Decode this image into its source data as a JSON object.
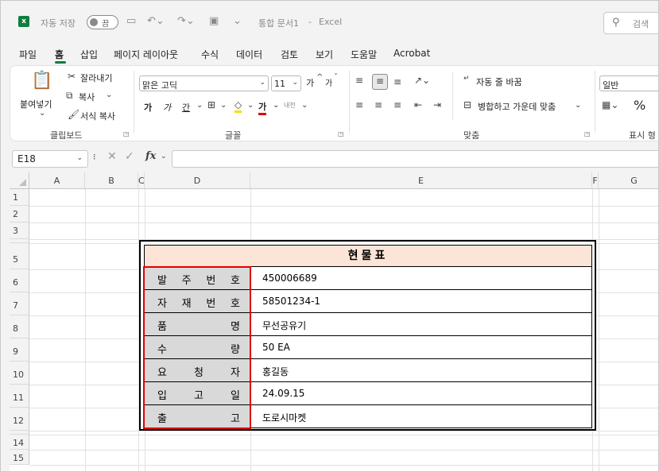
{
  "titlebar": {
    "autosave_label": "자동 저장",
    "autosave_state": "끔",
    "doc_title": "통합 문서1",
    "title_sep": "-",
    "app_name": "Excel",
    "search_placeholder": "검색"
  },
  "tabs": [
    {
      "label": "파일"
    },
    {
      "label": "홈"
    },
    {
      "label": "삽입"
    },
    {
      "label": "페이지 레이아웃"
    },
    {
      "label": "수식"
    },
    {
      "label": "데이터"
    },
    {
      "label": "검토"
    },
    {
      "label": "보기"
    },
    {
      "label": "도움말"
    },
    {
      "label": "Acrobat"
    }
  ],
  "ribbon": {
    "clipboard": {
      "paste": "붙여넣기",
      "cut": "잘라내기",
      "copy": "복사",
      "format_painter": "서식 복사",
      "group": "클립보드"
    },
    "font": {
      "font_name": "맑은 고딕",
      "font_size": "11",
      "bold": "가",
      "italic": "가",
      "underline": "간",
      "font_color_glyph": "가",
      "phonetic": "내천",
      "grow": "가",
      "shrink": "가",
      "group": "글꼴"
    },
    "alignment": {
      "wrap": "자동 줄 바꿈",
      "merge": "병합하고 가운데 맞춤",
      "group": "맞춤"
    },
    "number": {
      "format": "일반",
      "percent": "%",
      "group": "표시 형"
    }
  },
  "formula_bar": {
    "name_box": "E18",
    "formula": ""
  },
  "columns": [
    "A",
    "B",
    "C",
    "D",
    "E",
    "F",
    "G"
  ],
  "rows": [
    "1",
    "2",
    "3",
    "5",
    "6",
    "7",
    "8",
    "9",
    "10",
    "11",
    "12",
    "14",
    "15"
  ],
  "table": {
    "title": "현물표",
    "rows": [
      {
        "label": [
          "발",
          "주",
          "번",
          "호"
        ],
        "value": "450006689"
      },
      {
        "label": [
          "자",
          "재",
          "번",
          "호"
        ],
        "value": "58501234-1"
      },
      {
        "label": [
          "품",
          "명"
        ],
        "value": "무선공유기"
      },
      {
        "label": [
          "수",
          "량"
        ],
        "value": "50 EA"
      },
      {
        "label": [
          "요",
          "청",
          "자"
        ],
        "value": "홍길동"
      },
      {
        "label": [
          "입",
          "고",
          "일"
        ],
        "value": "24.09.15"
      },
      {
        "label": [
          "출",
          "고"
        ],
        "value": "도로시마켓"
      }
    ]
  },
  "colors": {
    "accent": "#107c41",
    "title_fill": "#fce4d6",
    "label_fill": "#d9d9d9",
    "highlight": "#e00000"
  }
}
